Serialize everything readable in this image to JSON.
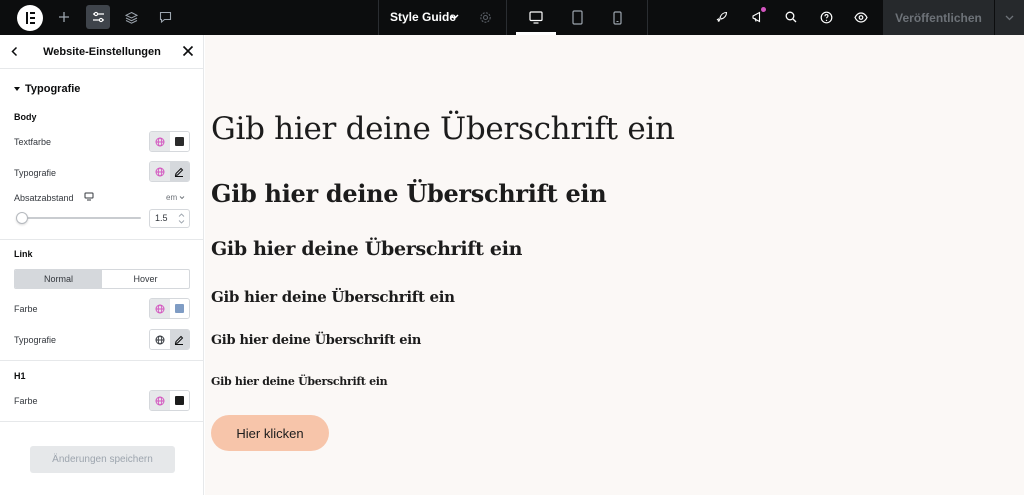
{
  "topbar": {
    "style_guide_label": "Style Guide",
    "publish_label": "Veröffentlichen"
  },
  "panel": {
    "title": "Website-Einstellungen",
    "section_title": "Typografie",
    "body": {
      "group_title": "Body",
      "text_color_label": "Textfarbe",
      "text_color": "#2b2b2b",
      "typography_label": "Typografie",
      "paragraph_spacing_label": "Absatzabstand",
      "unit": "em",
      "paragraph_spacing_value": "1.5"
    },
    "link": {
      "group_title": "Link",
      "tab_normal": "Normal",
      "tab_hover": "Hover",
      "color_label": "Farbe",
      "color": "#7f9cc4",
      "typography_label": "Typografie"
    },
    "h1": {
      "group_title": "H1",
      "color_label": "Farbe",
      "color": "#1c1c1c"
    },
    "save_label": "Änderungen speichern"
  },
  "canvas": {
    "background": "#fbf8f6",
    "headings": [
      "Gib hier deine Überschrift ein",
      "Gib hier deine Überschrift ein",
      "Gib hier deine Überschrift ein",
      "Gib hier deine Überschrift ein",
      "Gib hier deine Überschrift ein",
      "Gib hier deine Überschrift ein"
    ],
    "button_label": "Hier klicken",
    "button_color": "#f7c5aa"
  },
  "colors": {
    "topbar_bg": "#0c0d0e",
    "global_accent": "#d355bf"
  }
}
